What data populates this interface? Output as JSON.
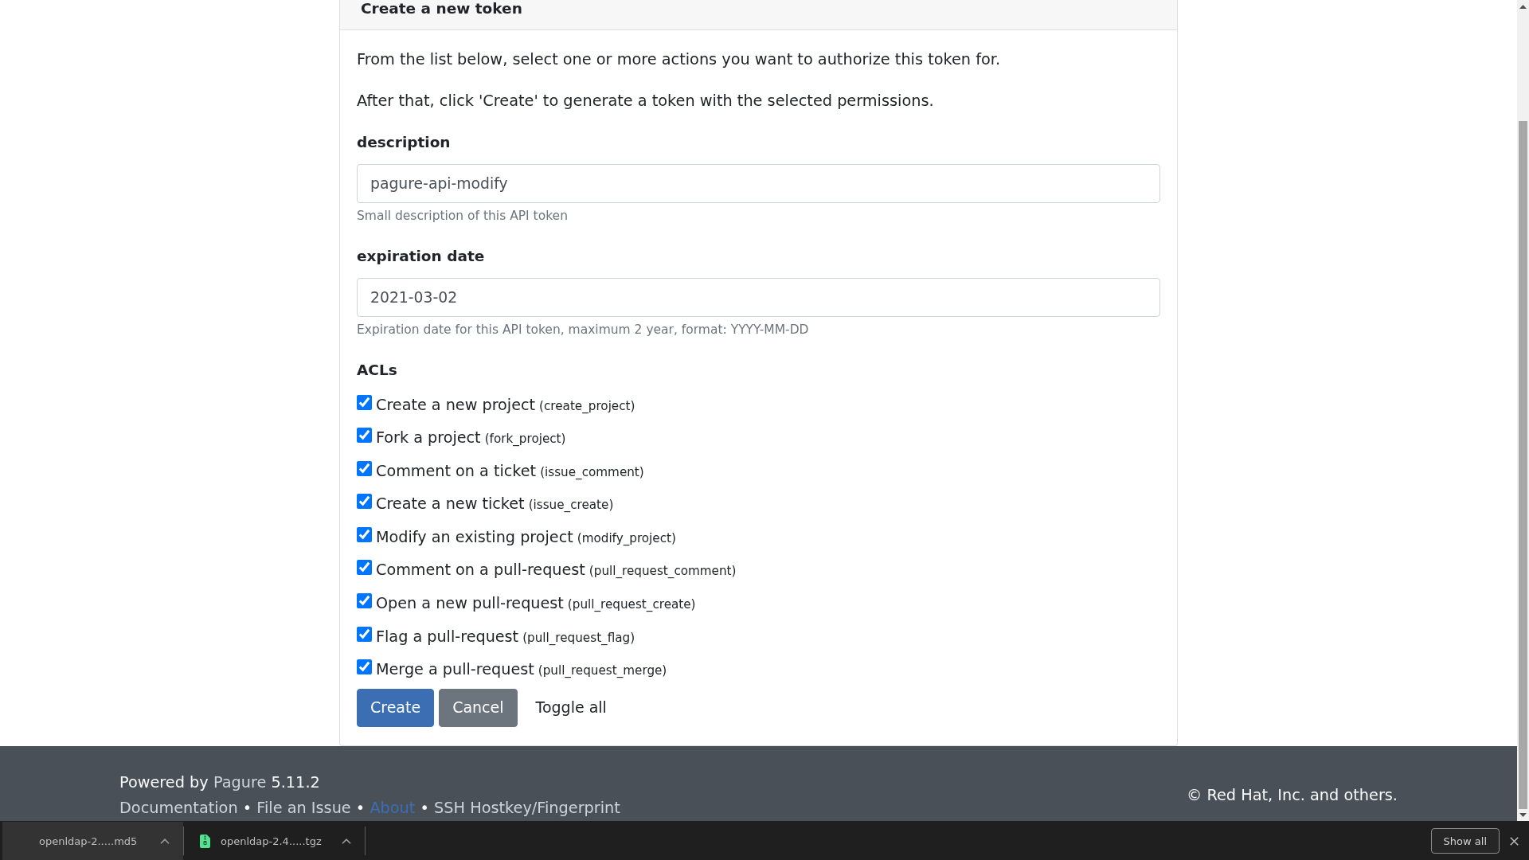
{
  "card": {
    "title": "Create a new token",
    "intro": [
      "From the list below, select one or more actions you want to authorize this token for.",
      "After that, click 'Create' to generate a token with the selected permissions."
    ],
    "fields": [
      {
        "label": "description",
        "value": "pagure-api-modify",
        "hint": "Small description of this API token"
      },
      {
        "label": "expiration date",
        "value": "2021-03-02",
        "hint": "Expiration date for this API token, maximum 2 year, format: YYYY-MM-DD"
      }
    ],
    "acls_heading": "ACLs",
    "acls": [
      {
        "label": "Create a new project",
        "code": "(create_project)",
        "checked": true
      },
      {
        "label": "Fork a project",
        "code": "(fork_project)",
        "checked": true
      },
      {
        "label": "Comment on a ticket",
        "code": "(issue_comment)",
        "checked": true
      },
      {
        "label": "Create a new ticket",
        "code": "(issue_create)",
        "checked": true
      },
      {
        "label": "Modify an existing project",
        "code": "(modify_project)",
        "checked": true
      },
      {
        "label": "Comment on a pull-request",
        "code": "(pull_request_comment)",
        "checked": true
      },
      {
        "label": "Open a new pull-request",
        "code": "(pull_request_create)",
        "checked": true
      },
      {
        "label": "Flag a pull-request",
        "code": "(pull_request_flag)",
        "checked": true
      },
      {
        "label": "Merge a pull-request",
        "code": "(pull_request_merge)",
        "checked": true
      }
    ],
    "buttons": [
      {
        "label": "Create",
        "kind": "primary"
      },
      {
        "label": "Cancel",
        "kind": "secondary"
      },
      {
        "label": "Toggle all",
        "kind": "link"
      }
    ]
  },
  "footer": {
    "powered_by": [
      {
        "kind": "text",
        "text": "Powered by"
      },
      {
        "kind": "link",
        "text": "Pagure"
      },
      {
        "kind": "text",
        "text": "5.11.2"
      }
    ],
    "links": [
      {
        "kind": "link",
        "text": "Documentation",
        "color": "#ced4da"
      },
      {
        "kind": "separator",
        "text": "•"
      },
      {
        "kind": "link",
        "text": "File an Issue",
        "color": "#ced4da"
      },
      {
        "kind": "separator",
        "text": "•"
      },
      {
        "kind": "link",
        "text": "About",
        "color": "#3c6eb4"
      },
      {
        "kind": "separator",
        "text": "•"
      },
      {
        "kind": "link",
        "text": "SSH Hostkey/Fingerprint",
        "color": "#ced4da"
      }
    ],
    "copyright": "© Red Hat, Inc. and others."
  },
  "downloads": {
    "items": [
      {
        "file": "openldap-2.....md5",
        "selected": true,
        "icon": false
      },
      {
        "file": "openldap-2.4.....tgz",
        "selected": false,
        "icon": true
      }
    ],
    "show_all": "Show all"
  }
}
